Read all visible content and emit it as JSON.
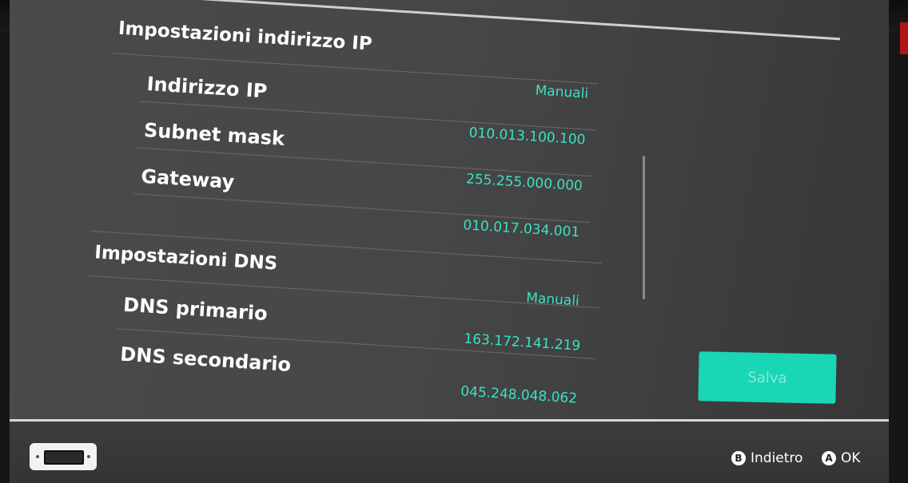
{
  "ip_settings": {
    "title": "Impostazioni indirizzo IP",
    "mode_value": "Manuali",
    "rows": [
      {
        "label": "Indirizzo IP",
        "value": "010.013.100.100"
      },
      {
        "label": "Subnet mask",
        "value": "255.255.000.000"
      },
      {
        "label": "Gateway",
        "value": "010.017.034.001"
      }
    ]
  },
  "dns_settings": {
    "title": "Impostazioni DNS",
    "mode_value": "Manuali",
    "rows": [
      {
        "label": "DNS primario",
        "value": "163.172.141.219"
      },
      {
        "label": "DNS secondario",
        "value": "045.248.048.062"
      }
    ]
  },
  "save_button": {
    "label": "Salva"
  },
  "footer": {
    "back_key": "B",
    "back_label": "Indietro",
    "ok_key": "A",
    "ok_label": "OK"
  },
  "colors": {
    "accent": "#19d6b5",
    "value_text": "#3ee0c0",
    "background": "#454545"
  }
}
